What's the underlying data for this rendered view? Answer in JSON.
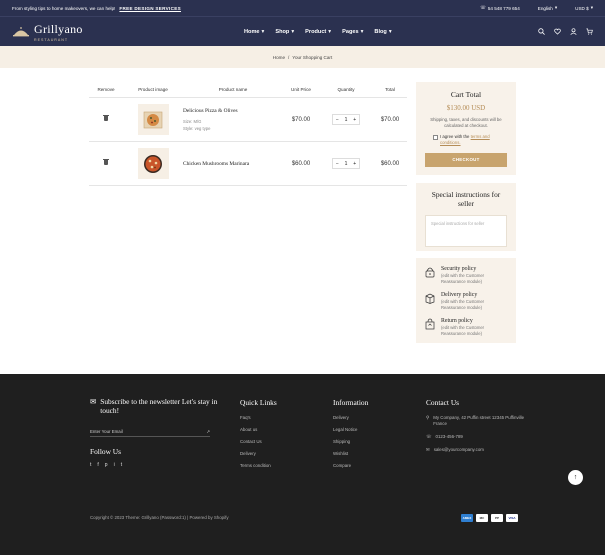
{
  "topbar": {
    "message": "From styling tips to home makeovers, we can help!",
    "link": "FREE DESIGN SERVICES",
    "phone": "54 548 779 654",
    "language": "English",
    "currency": "USD $"
  },
  "header": {
    "logo_name": "Grillyano",
    "logo_sub": "RESTAURANT",
    "nav": [
      "Home",
      "Shop",
      "Product",
      "Pages",
      "Blog"
    ]
  },
  "breadcrumb": {
    "home": "Home",
    "sep": "/",
    "current": "Your Shopping Cart"
  },
  "cart": {
    "headers": {
      "remove": "Remove",
      "image": "Product image",
      "name": "Product name",
      "price": "Unit Price",
      "qty": "Quantity",
      "total": "Total"
    },
    "items": [
      {
        "name": "Delicious Pizza & Olives",
        "size": "Size: M/G",
        "style": "Style: veg type",
        "price": "$70.00",
        "qty": "1",
        "total": "$70.00",
        "minus": "−",
        "plus": "+"
      },
      {
        "name": "Chicken Mushrooms Marinara",
        "price": "$60.00",
        "qty": "1",
        "total": "$60.00",
        "minus": "−",
        "plus": "+"
      }
    ]
  },
  "total_box": {
    "title": "Cart Total",
    "amount": "$130.00 USD",
    "note": "Shipping, taxes, and discounts will be calculated at checkout.",
    "agree_prefix": "I agree with the",
    "agree_link": "terms and conditions.",
    "checkout": "CHECKOUT"
  },
  "instructions": {
    "title": "Special instructions for seller",
    "placeholder": "Special instructions for seller"
  },
  "policies": [
    {
      "title": "Security policy",
      "desc": "(edit with the Customer Reassurance module)"
    },
    {
      "title": "Delivery policy",
      "desc": "(edit with the Customer Reassurance module)"
    },
    {
      "title": "Return policy",
      "desc": "(edit with the Customer Reassurance module)"
    }
  ],
  "footer": {
    "newsletter_title": "Subscribe to the newsletter Let's stay in touch!",
    "email_placeholder": "Enter Your Email",
    "follow": "Follow Us",
    "social": [
      "t",
      "f",
      "p",
      "i",
      "t"
    ],
    "quick_links_title": "Quick Links",
    "quick_links": [
      "Faq's",
      "About us",
      "Contact Us",
      "Delivery",
      "Terms condition"
    ],
    "information_title": "Information",
    "information": [
      "Delivery",
      "Legal Notice",
      "Shipping",
      "Wishlist",
      "Compare"
    ],
    "contact_title": "Contact Us",
    "contact": {
      "address": "My Company, 42 Puffin street 12345 Puffinville France",
      "phone": "0123-456-789",
      "email": "sales@yourcompany.com"
    },
    "copyright": "Copyright © 2023 Theme: Grillyano (Password:1) | Powered by Shopify",
    "payments": [
      "AMEX",
      "MC",
      "PP",
      "VISA"
    ]
  }
}
